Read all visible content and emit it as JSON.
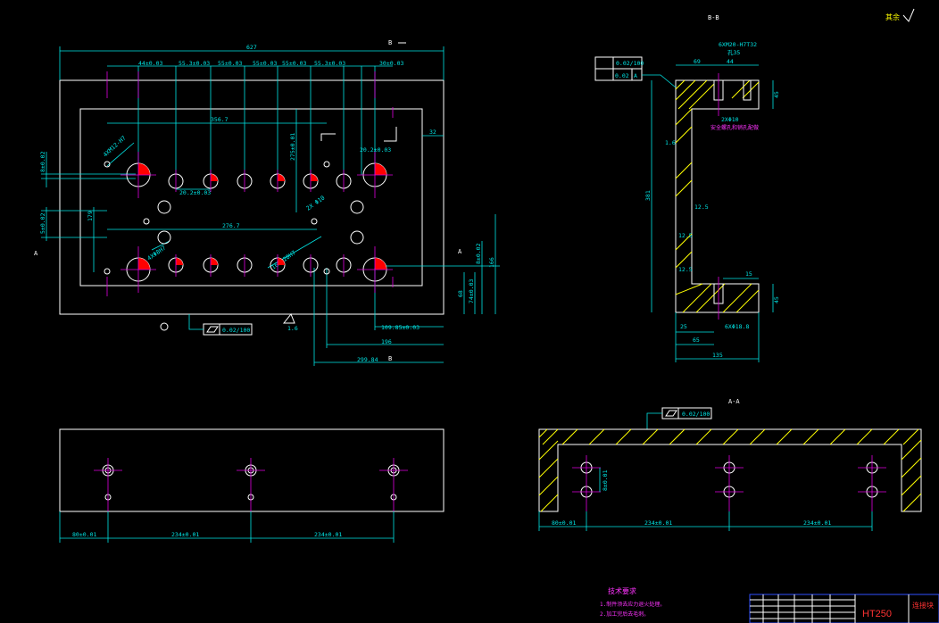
{
  "top_view": {
    "overall_width": "627",
    "dims_top": [
      "44±0.03",
      "55.3±0.03",
      "55±0.03",
      "55±0.03",
      "55±0.03",
      "55.3±0.03",
      "30±0.03"
    ],
    "dim_356": "356.7",
    "dim_276": "276.7",
    "dim_32": "32",
    "dim_20_2_a": "20.2±0.03",
    "dim_20_2_b": "20.2±0.03",
    "dim_275": "275±0.01",
    "dim_8_left": "8±0.02",
    "dim_5_left": "5±0.02",
    "dim_179": "179",
    "dim_4x": "4XM12-H7",
    "dim_4xb": "4XΦ8H7",
    "dim_16x": "16XΦ20H7",
    "dim_right_8": "8±0.02",
    "dim_166": "166",
    "dim_68": "68",
    "dim_74": "74±0.03",
    "dim_109": "109.85±0.03",
    "dim_196": "196",
    "dim_299": "299.84",
    "flatness": "0.02/100",
    "roughness_left": "1.6",
    "section_b_top": "B",
    "section_b_bot": "B",
    "section_a": "A",
    "section_a_right": "A"
  },
  "section_bb": {
    "title": "B-B",
    "tol_flat": "0.02/100",
    "tol_perp": "0.02",
    "tol_datum": "A",
    "dim_thread": "6XM20-H7T32",
    "dim_depth": "孔35",
    "dim_69": "69",
    "dim_44": "44",
    "dim_45_top": "45",
    "dim_381": "381",
    "dim_2x": "2XΦ10",
    "note_cn": "安全螺孔和销孔配做",
    "dim_1_6": "1.6",
    "dim_12_5a": "12.5",
    "dim_12_5b": "12.5",
    "dim_12_5c": "12.5",
    "dim_15": "15",
    "dim_45_bot": "45",
    "dim_25": "25",
    "dim_65": "65",
    "dim_6x": "6XΦ18.8",
    "dim_135": "135",
    "roughness_note": "其余"
  },
  "bottom_left": {
    "dim_80": "80±0.01",
    "dim_234a": "234±0.01",
    "dim_234b": "234±0.01"
  },
  "section_aa": {
    "title": "A-A",
    "flatness": "0.02/100",
    "dim_80": "80±0.01",
    "dim_234a": "234±0.01",
    "dim_234b": "234±0.01",
    "dim_v": "8±0.01"
  },
  "notes": {
    "title": "技术要求",
    "line1": "1.制件须去应力退火处理。",
    "line2": "2.加工完后去毛刺。"
  },
  "title_block": {
    "material": "HT250",
    "name": "连接块"
  },
  "colors": {
    "background": "#000000",
    "outline": "#ffffff",
    "dimension": "#00e5e5",
    "center": "#e000e0",
    "hatch": "#ffff00",
    "highlight": "#ff0000",
    "border": "#3050ff"
  }
}
